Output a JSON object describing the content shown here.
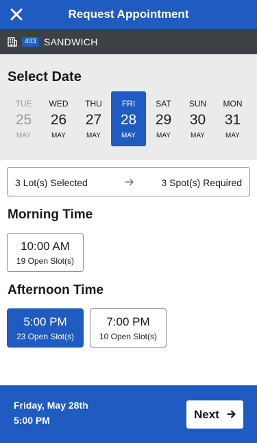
{
  "header": {
    "title": "Request Appointment",
    "close_icon": "close-icon"
  },
  "site": {
    "icon": "building-icon",
    "number": "403",
    "name": "SANDWICH"
  },
  "date_section": {
    "title": "Select Date",
    "dates": [
      {
        "dow": "TUE",
        "day": "25",
        "month": "MAY",
        "state": "disabled"
      },
      {
        "dow": "WED",
        "day": "26",
        "month": "MAY",
        "state": "available"
      },
      {
        "dow": "THU",
        "day": "27",
        "month": "MAY",
        "state": "available"
      },
      {
        "dow": "FRI",
        "day": "28",
        "month": "MAY",
        "state": "selected"
      },
      {
        "dow": "SAT",
        "day": "29",
        "month": "MAY",
        "state": "available"
      },
      {
        "dow": "SUN",
        "day": "30",
        "month": "MAY",
        "state": "available"
      },
      {
        "dow": "MON",
        "day": "31",
        "month": "MAY",
        "state": "available"
      }
    ]
  },
  "summary": {
    "lots": "3 Lot(s) Selected",
    "spots": "3 Spot(s) Required",
    "arrow_icon": "arrow-right-icon"
  },
  "morning": {
    "title": "Morning Time",
    "slots": [
      {
        "time": "10:00 AM",
        "open": "19 Open Slot(s)",
        "selected": false
      }
    ]
  },
  "afternoon": {
    "title": "Afternoon Time",
    "slots": [
      {
        "time": "5:00 PM",
        "open": "23 Open Slot(s)",
        "selected": true
      },
      {
        "time": "7:00 PM",
        "open": "10 Open Slot(s)",
        "selected": false
      }
    ]
  },
  "footer": {
    "date": "Friday, May 28th",
    "time": "5:00 PM",
    "next_label": "Next",
    "next_icon": "arrow-right-icon"
  },
  "colors": {
    "primary": "#1f5bc0",
    "site_bar": "#3d4045",
    "date_bg": "#ebebeb",
    "disabled_text": "#9a9a9a"
  }
}
